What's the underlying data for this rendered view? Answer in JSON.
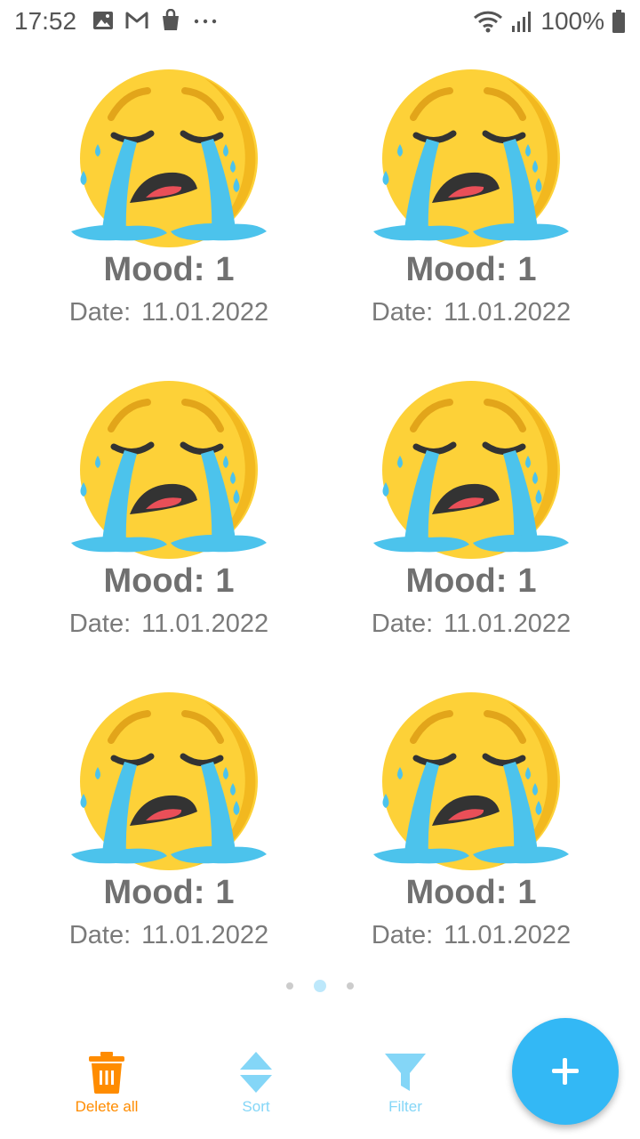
{
  "status_bar": {
    "time": "17:52",
    "left_icons": [
      "gallery-icon",
      "gmail-icon",
      "shopping-bag-icon",
      "more-dots-icon"
    ],
    "right_icons": [
      "wifi-icon",
      "signal-icon",
      "battery-icon"
    ],
    "battery": "100%"
  },
  "entries": [
    {
      "emoji": "loudly-crying-face-icon",
      "mood_label": "Mood:",
      "mood_value": "1",
      "date_label": "Date:",
      "date_value": "11.01.2022"
    },
    {
      "emoji": "loudly-crying-face-icon",
      "mood_label": "Mood:",
      "mood_value": "1",
      "date_label": "Date:",
      "date_value": "11.01.2022"
    },
    {
      "emoji": "loudly-crying-face-icon",
      "mood_label": "Mood:",
      "mood_value": "1",
      "date_label": "Date:",
      "date_value": "11.01.2022"
    },
    {
      "emoji": "loudly-crying-face-icon",
      "mood_label": "Mood:",
      "mood_value": "1",
      "date_label": "Date:",
      "date_value": "11.01.2022"
    },
    {
      "emoji": "loudly-crying-face-icon",
      "mood_label": "Mood:",
      "mood_value": "1",
      "date_label": "Date:",
      "date_value": "11.01.2022"
    },
    {
      "emoji": "loudly-crying-face-icon",
      "mood_label": "Mood:",
      "mood_value": "1",
      "date_label": "Date:",
      "date_value": "11.01.2022"
    }
  ],
  "pager": {
    "pages": 3,
    "current": 2
  },
  "bottom_nav": {
    "delete_all": {
      "label": "Delete all",
      "icon": "trash-icon",
      "color": "#ff8c00"
    },
    "sort": {
      "label": "Sort",
      "icon": "sort-icon",
      "color": "#84d6f7"
    },
    "filter": {
      "label": "Filter",
      "icon": "filter-icon",
      "color": "#84d6f7"
    }
  },
  "fab": {
    "icon": "plus-icon",
    "color": "#33b8f5"
  },
  "colors": {
    "emoji_face": "#fdd138",
    "emoji_shade": "#f2b81f",
    "tears": "#4cc3ec",
    "mouth": "#333333",
    "tongue": "#e94f58",
    "mood_text": "#707070",
    "date_text": "#7a7a7a",
    "dot_active": "#bde8fb",
    "dot_inactive": "#cccccc"
  }
}
